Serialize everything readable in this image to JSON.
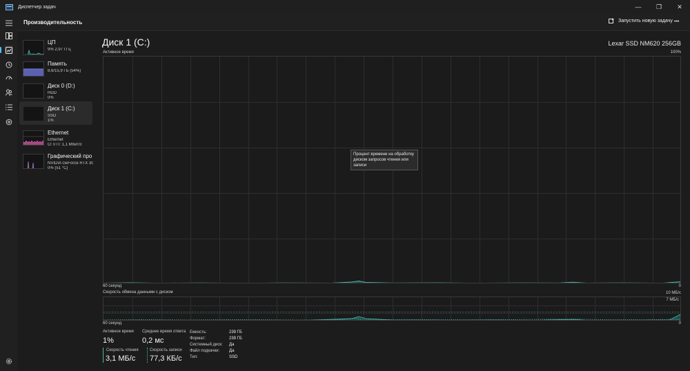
{
  "window": {
    "title": "Диспетчер задач",
    "controls": {
      "minimize": "—",
      "maximize": "❐",
      "close": "✕"
    }
  },
  "header": {
    "title": "Производительность",
    "run_task_label": "Запустить новую задачу",
    "more_label": "•••"
  },
  "nav": {
    "items": [
      {
        "name": "menu-icon"
      },
      {
        "name": "processes-icon"
      },
      {
        "name": "performance-icon",
        "active": true
      },
      {
        "name": "app-history-icon"
      },
      {
        "name": "startup-icon"
      },
      {
        "name": "users-icon"
      },
      {
        "name": "details-icon"
      },
      {
        "name": "services-icon"
      }
    ],
    "settings": "settings-icon"
  },
  "devices": [
    {
      "name": "ЦП",
      "line1": "9% 2,97 ГГц",
      "line2": "",
      "color": "#4fb7b0",
      "level": 0.09
    },
    {
      "name": "Память",
      "line1": "8,6/15,9 ГБ (54%)",
      "line2": "",
      "color": "#7b83e0",
      "level": 0.54
    },
    {
      "name": "Диск 0 (D:)",
      "line1": "HDD",
      "line2": "0%",
      "color": "#4fb7b0",
      "level": 0
    },
    {
      "name": "Диск 1 (C:)",
      "line1": "SSD",
      "line2": "1%",
      "color": "#4fb7b0",
      "level": 0.01,
      "selected": true
    },
    {
      "name": "Ethernet",
      "line1": "Ethernet",
      "line2": "О: 0 П: 1,1 Мбит/с",
      "color": "#d86cb4",
      "level": 0.3
    },
    {
      "name": "Графический про",
      "line1": "NVIDIA GeForce RTX 306",
      "line2": "0% (51 °C)",
      "color": "#b58bd8",
      "level": 0.05
    }
  ],
  "main": {
    "title": "Диск 1 (C:)",
    "model": "Lexar SSD NM620 256GB",
    "active_graph": {
      "label": "Активное время",
      "max": "100%",
      "x_left": "60 секунд",
      "x_right": "0",
      "tooltip": "Процент времени на обработку диском запросов чтения или записи"
    },
    "transfer_graph": {
      "label": "Скорость обмена данными с диском",
      "max": "10 МБ/с",
      "secondary": "7 МБ/с",
      "x_left": "60 секунд",
      "x_right": "0"
    },
    "stats": {
      "active_time_label": "Активное время",
      "active_time": "1%",
      "avg_response_label": "Среднее время ответа",
      "avg_response": "0,2 мс",
      "read_label": "Скорость чтения",
      "read": "3,1 МБ/с",
      "write_label": "Скорость записи",
      "write": "77,3 КБ/с"
    },
    "info": [
      {
        "key": "Емкость:",
        "value": "239 ГБ"
      },
      {
        "key": "Формат:",
        "value": "239 ГБ"
      },
      {
        "key": "Системный диск:",
        "value": "Да"
      },
      {
        "key": "Файл подкачки:",
        "value": "Да"
      },
      {
        "key": "Тип:",
        "value": "SSD"
      }
    ]
  },
  "colors": {
    "accent": "#4cc2ff",
    "disk_line": "#4fb7b0",
    "background": "#1c1c1c"
  }
}
